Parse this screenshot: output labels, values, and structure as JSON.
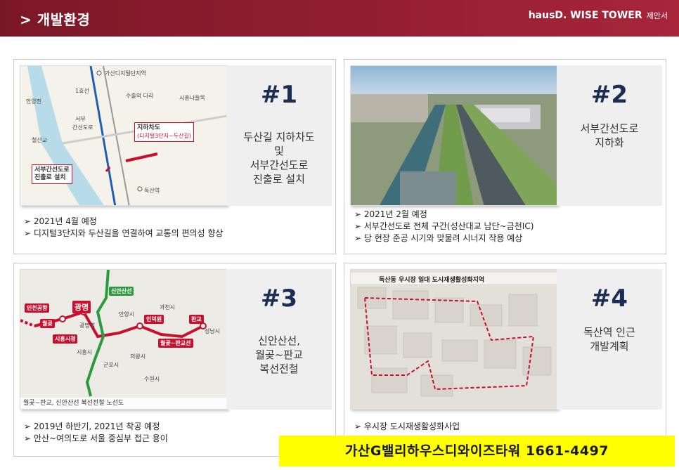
{
  "header": {
    "title": "> 개발환경",
    "brand": "hausD. WISE TOWER",
    "brand_sub": "제안서"
  },
  "cards": [
    {
      "num": "#1",
      "desc": [
        "두산길 지하차도",
        "및",
        "서부간선도로",
        "진출로 설치"
      ],
      "bullets": [
        "2021년 4월 예정",
        "디지털3단지와 두산길을 연결하여 교통의 편의성 향상"
      ],
      "map": {
        "labels": [
          "가산디지털단지역",
          "1호선",
          "수출의 다리",
          "안양천",
          "서부",
          "간선도로",
          "시흥나들목",
          "철산교",
          "독산역"
        ],
        "box1": [
          "지하차도",
          "(디지털3단지~두산길)"
        ],
        "box2": [
          "서부간선도로",
          "진출로 설치"
        ]
      }
    },
    {
      "num": "#2",
      "desc": [
        "서부간선도로",
        "지하화"
      ],
      "bullets": [
        "2021년 2월 예정",
        "서부간선도로 전체 구간(성산대교 남단~금천IC)",
        "당 현장 준공 시기와 맞물려 시너지 작용 예상"
      ]
    },
    {
      "num": "#3",
      "desc": [
        "신안산선,",
        "월곶~판교",
        "복선전철"
      ],
      "bullets": [
        "2019년 하반기, 2021년 착공 예정",
        "안산~여의도로 서울 중심부 접근 용이"
      ],
      "map": {
        "caption": "월곶~판교, 신안산선 복선전철 노선도",
        "red_labels": [
          "인천공항",
          "광명",
          "월곶",
          "시흥시청",
          "인덕원",
          "판교",
          "월곶~판교선"
        ],
        "green_label": "신안산선",
        "labels": [
          "광명역",
          "안양시",
          "과천시",
          "성남시",
          "군포시",
          "수원시",
          "시흥시",
          "의왕시"
        ]
      }
    },
    {
      "num": "#4",
      "desc": [
        "독산역 인근",
        "개발계획"
      ],
      "bullets": [
        "우시장 도시재생활성화사업"
      ],
      "map": {
        "title": "독산동 우시장 일대 도시재생활성화지역"
      }
    }
  ],
  "banner": "가산G밸리하우스디와이즈타워 1661-4497"
}
